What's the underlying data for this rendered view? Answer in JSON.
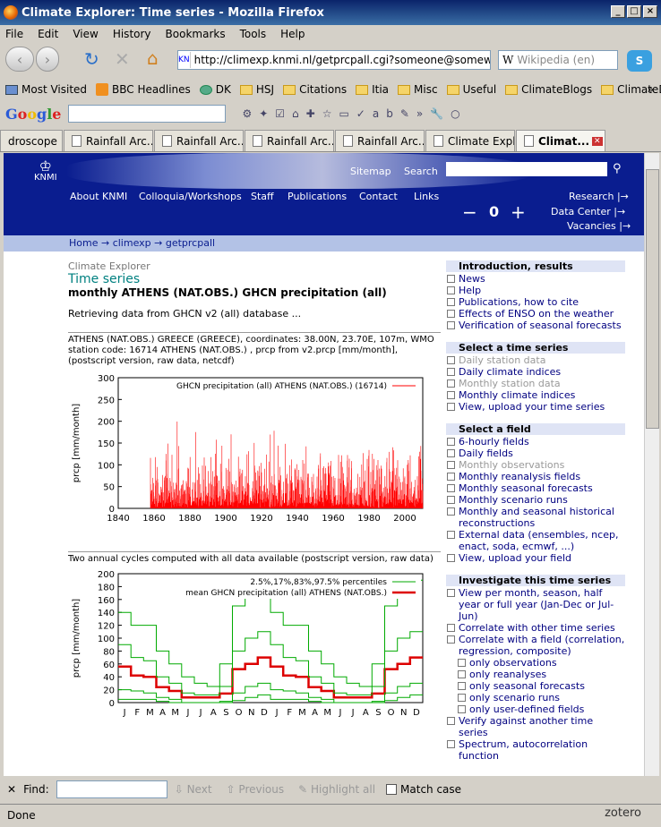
{
  "window": {
    "title": "Climate Explorer: Time series - Mozilla Firefox"
  },
  "menu": [
    "File",
    "Edit",
    "View",
    "History",
    "Bookmarks",
    "Tools",
    "Help"
  ],
  "url": "http://climexp.knmi.nl/getprcpall.cgi?someone@somewher",
  "search_placeholder": "Wikipedia (en)",
  "bookmarks": [
    "Most Visited",
    "BBC Headlines",
    "DK",
    "HSJ",
    "Citations",
    "Itia",
    "Misc",
    "Useful",
    "ClimateBlogs",
    "ClimateData"
  ],
  "tabs": [
    "droscope",
    "Rainfall Arc...",
    "Rainfall Arc...",
    "Rainfall Arc...",
    "Rainfall Arc...",
    "Climate Expl...",
    "Climat..."
  ],
  "header": {
    "logo": "KNMI",
    "sitemap": "Sitemap",
    "search": "Search",
    "nav": [
      "About KNMI",
      "Colloquia/Workshops",
      "Staff",
      "Publications",
      "Contact",
      "Links"
    ],
    "right_links": [
      "Research |→",
      "Data Center |→",
      "Vacancies |→"
    ],
    "counter": "0"
  },
  "breadcrumb": "Home → climexp → getprcpall",
  "main": {
    "section": "Climate Explorer",
    "title": "Time series",
    "subtitle": "monthly ATHENS (NAT.OBS.) GHCN precipitation (all)",
    "retrieving": "Retrieving data from GHCN v2 (all) database ...",
    "station_info": "ATHENS (NAT.OBS.) GREECE (GREECE), coordinates: 38.00N, 23.70E, 107m, WMO station code: 16714 ATHENS (NAT.OBS.) , prcp from v2.prcp [mm/month], (postscript version, raw data, netcdf)",
    "cycles_text": "Two annual cycles computed with all data available (postscript version, raw data)"
  },
  "sidebar": {
    "sections": [
      {
        "title": "Introduction, results",
        "items": [
          "News",
          "Help",
          "Publications, how to cite",
          "Effects of ENSO on the weather",
          "Verification of seasonal forecasts"
        ]
      },
      {
        "title": "Select a time series",
        "items": [
          "Daily station data",
          "Daily climate indices",
          "Monthly station data",
          "Monthly climate indices",
          "View, upload your time series"
        ]
      },
      {
        "title": "Select a field",
        "items": [
          "6-hourly fields",
          "Daily fields",
          "Monthly observations",
          "Monthly reanalysis fields",
          "Monthly seasonal forecasts",
          "Monthly scenario runs",
          "Monthly and seasonal historical reconstructions",
          "External data (ensembles, ncep, enact, soda, ecmwf, ...)",
          "View, upload your field"
        ]
      },
      {
        "title": "Investigate this time series",
        "items": [
          "View per month, season, half year or full year (Jan-Dec or Jul-Jun)",
          "Correlate with other time series",
          "Correlate with a field (correlation, regression, composite)",
          "only observations",
          "only reanalyses",
          "only seasonal forecasts",
          "only scenario runs",
          "only user-defined fields",
          "Verify against another time series",
          "Spectrum, autocorrelation function"
        ]
      }
    ]
  },
  "chart_data": [
    {
      "type": "bar",
      "legend": "GHCN precipitation (all) ATHENS (NAT.OBS.) (16714)",
      "ylabel": "prcp [mm/month]",
      "xlim": [
        1840,
        2010
      ],
      "ylim": [
        0,
        300
      ],
      "xticks": [
        1840,
        1860,
        1880,
        1900,
        1920,
        1940,
        1960,
        1980,
        2000
      ],
      "yticks": [
        0,
        50,
        100,
        150,
        200,
        250,
        300
      ],
      "color": "#ff0000",
      "x_range_data": [
        1858,
        2010
      ]
    },
    {
      "type": "line",
      "legend": [
        "2.5%,17%,83%,97.5% percentiles",
        "mean GHCN precipitation (all) ATHENS (NAT.OBS.)"
      ],
      "ylabel": "prcp [mm/month]",
      "categories": [
        "J",
        "F",
        "M",
        "A",
        "M",
        "J",
        "J",
        "A",
        "S",
        "O",
        "N",
        "D",
        "J",
        "F",
        "M",
        "A",
        "M",
        "J",
        "J",
        "A",
        "S",
        "O",
        "N",
        "D"
      ],
      "ylim": [
        0,
        200
      ],
      "yticks": [
        0,
        20,
        40,
        60,
        80,
        100,
        120,
        140,
        160,
        180,
        200
      ],
      "series": [
        {
          "name": "mean",
          "color": "#dd0000",
          "values": [
            56,
            42,
            40,
            24,
            18,
            8,
            8,
            8,
            14,
            52,
            60,
            70,
            56,
            42,
            40,
            24,
            18,
            8,
            8,
            8,
            14,
            52,
            60,
            70
          ]
        },
        {
          "name": "2.5%",
          "color": "#00aa00",
          "values": [
            5,
            5,
            5,
            2,
            0,
            0,
            0,
            0,
            0,
            3,
            8,
            12,
            5,
            5,
            5,
            2,
            0,
            0,
            0,
            0,
            0,
            3,
            8,
            12
          ]
        },
        {
          "name": "17%",
          "color": "#00aa00",
          "values": [
            20,
            18,
            15,
            8,
            5,
            0,
            0,
            0,
            2,
            15,
            25,
            30,
            20,
            18,
            15,
            8,
            5,
            0,
            0,
            0,
            2,
            15,
            25,
            30
          ]
        },
        {
          "name": "83%",
          "color": "#00aa00",
          "values": [
            90,
            70,
            65,
            40,
            30,
            15,
            12,
            12,
            25,
            80,
            100,
            110,
            90,
            70,
            65,
            40,
            30,
            15,
            12,
            12,
            25,
            80,
            100,
            110
          ]
        },
        {
          "name": "97.5%",
          "color": "#00aa00",
          "values": [
            140,
            120,
            120,
            80,
            60,
            40,
            30,
            25,
            60,
            150,
            180,
            190,
            140,
            120,
            120,
            80,
            60,
            40,
            30,
            25,
            60,
            150,
            180,
            190
          ]
        }
      ]
    }
  ],
  "findbar": {
    "label": "Find:",
    "next": "Next",
    "previous": "Previous",
    "highlight": "Highlight all",
    "match": "Match case"
  },
  "status": {
    "text": "Done",
    "zotero": "zotero"
  }
}
